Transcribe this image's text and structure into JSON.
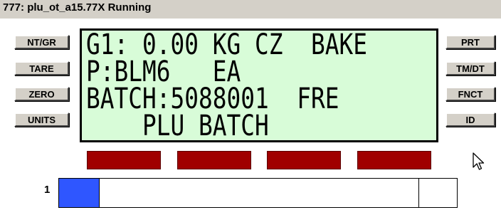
{
  "window": {
    "title": "777: plu_ot_a15.77X Running"
  },
  "left_buttons": [
    {
      "label": "NT/GR"
    },
    {
      "label": "TARE"
    },
    {
      "label": "ZERO"
    },
    {
      "label": "UNITS"
    }
  ],
  "right_buttons": [
    {
      "label": "PRT"
    },
    {
      "label": "TM/DT"
    },
    {
      "label": "FNCT"
    },
    {
      "label": "ID"
    }
  ],
  "display": {
    "line1": "G1: 0.00 KG CZ  BAKE",
    "line2": "P:BLM6   EA",
    "line3": "BATCH:5088001  FRE",
    "line4": "    PLU BATCH"
  },
  "indicator_lamps": {
    "count": 4,
    "color": "#a00000"
  },
  "progress": {
    "index_label": "1",
    "value": 0.1,
    "fill_color": "#2f56ff"
  },
  "colors": {
    "display_background": "#d8fcd8",
    "title_background": "#d4d0c8",
    "button_face": "#d4d0c8"
  },
  "icons": {
    "cursor": "mouse-pointer-icon"
  }
}
